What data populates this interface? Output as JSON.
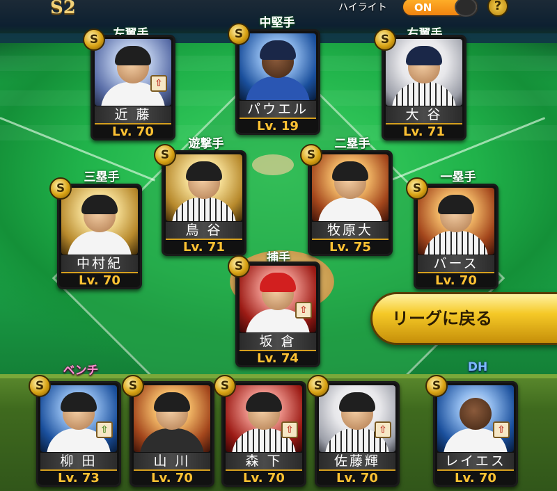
{
  "header": {
    "season_badge": "S2",
    "highlight_label": "ハイライト",
    "highlight_toggle": "ON",
    "help_symbol": "?"
  },
  "positions": {
    "lf": "左翼手",
    "cf": "中堅手",
    "rf": "右翼手",
    "ss": "遊撃手",
    "2b": "二塁手",
    "3b": "三塁手",
    "1b": "一塁手",
    "c": "捕手",
    "bench": "ベンチ",
    "dh": "DH"
  },
  "players": [
    {
      "name": "近 藤",
      "level": "Lv. 70",
      "rank": "S"
    },
    {
      "name": "パウエル",
      "level": "Lv. 19",
      "rank": "S"
    },
    {
      "name": "大 谷",
      "level": "Lv. 71",
      "rank": "S"
    },
    {
      "name": "鳥 谷",
      "level": "Lv. 71",
      "rank": "S"
    },
    {
      "name": "牧原大",
      "level": "Lv. 75",
      "rank": "S"
    },
    {
      "name": "中村紀",
      "level": "Lv. 70",
      "rank": "S"
    },
    {
      "name": "バース",
      "level": "Lv. 70",
      "rank": "S"
    },
    {
      "name": "坂 倉",
      "level": "Lv. 74",
      "rank": "S"
    },
    {
      "name": "柳 田",
      "level": "Lv. 73",
      "rank": "S"
    },
    {
      "name": "山 川",
      "level": "Lv. 70",
      "rank": "S"
    },
    {
      "name": "森 下",
      "level": "Lv. 70",
      "rank": "S"
    },
    {
      "name": "佐藤輝",
      "level": "Lv. 70",
      "rank": "S"
    },
    {
      "name": "レイエス",
      "level": "Lv. 70",
      "rank": "S"
    }
  ],
  "actions": {
    "return_league": "リーグに戻る"
  }
}
